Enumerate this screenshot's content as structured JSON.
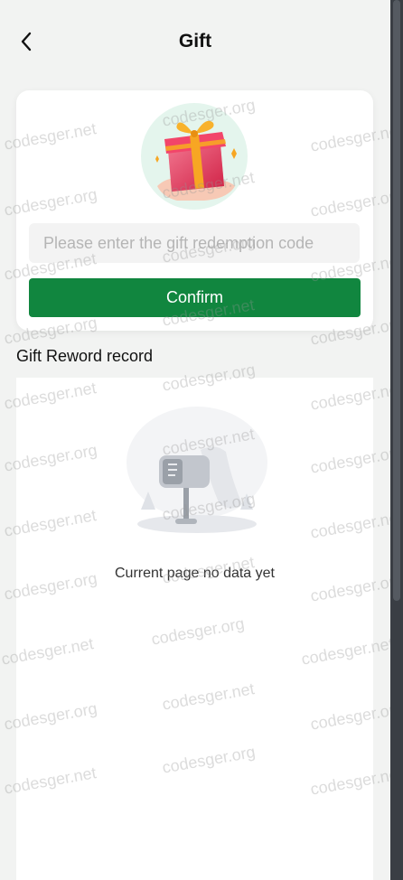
{
  "header": {
    "title": "Gift"
  },
  "redeem": {
    "placeholder": "Please enter the gift redemption code",
    "value": "",
    "confirm_label": "Confirm"
  },
  "records": {
    "section_title": "Gift Reword record",
    "empty_text": "Current page no data yet"
  },
  "watermarks": {
    "net": "codesger.net",
    "org": "codesger.org"
  },
  "colors": {
    "accent": "#11863f",
    "background": "#f2f3f2",
    "gift_circle": "#e4f5ed"
  },
  "icons": {
    "back": "back-arrow-icon",
    "gift": "gift-box-icon",
    "empty": "empty-mailbox-icon"
  }
}
